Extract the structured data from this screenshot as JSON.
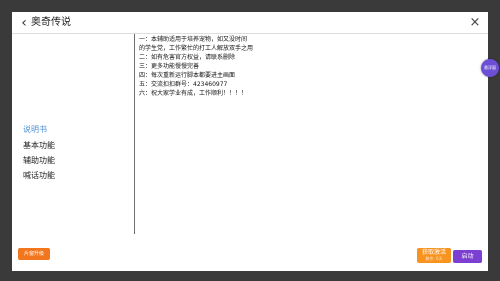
{
  "window": {
    "title": "奥奇传说",
    "back_icon": "‹",
    "close_icon": "×"
  },
  "sidebar": {
    "items": [
      {
        "label": "说明书",
        "active": true
      },
      {
        "label": "基本功能",
        "active": false
      },
      {
        "label": "辅助功能",
        "active": false
      },
      {
        "label": "喊话功能",
        "active": false
      }
    ]
  },
  "content": {
    "lines": [
      "一：本辅助适用于培养宠物，如又没时间",
      "的学生党，工作繁忙的打工人解放双手之用",
      "二：如有危害官方权益，请联系删除",
      "三：更多功能慢慢完善",
      "四：每次重新运行脚本都要进主画面",
      "五：交流扣扣群号：423460977",
      "六：祝大家学业有成，工作顺利！！！！"
    ]
  },
  "footer": {
    "update_label": "片窗升级",
    "activation_label": "获取激活",
    "activation_sub": "剩余: 0天",
    "start_label": "启动"
  },
  "floating": {
    "badge_label": "悬浮窗"
  },
  "colors": {
    "accent_blue": "#4b8fd6",
    "update_orange": "#f2761e",
    "activation_orange": "#f7931e",
    "start_purple": "#7c3fd1",
    "badge_purple": "#6d4fd6"
  }
}
